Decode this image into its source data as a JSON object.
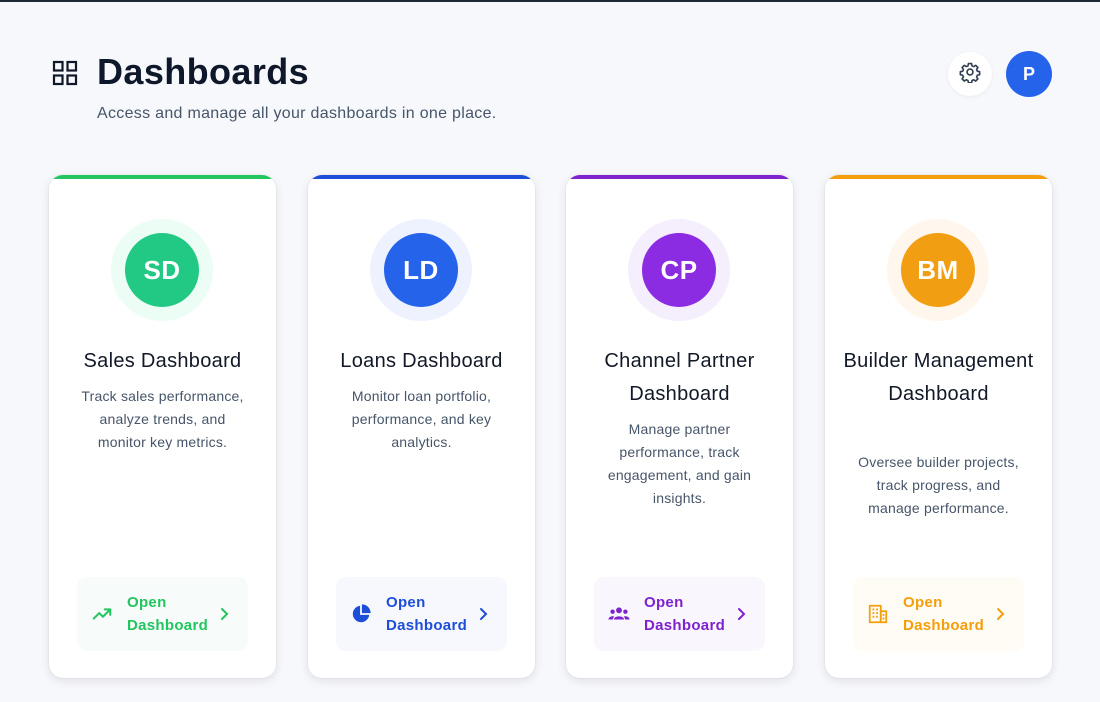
{
  "header": {
    "title": "Dashboards",
    "subtitle": "Access and manage all your dashboards in one place.",
    "avatar_initial": "P"
  },
  "cards": [
    {
      "initials": "SD",
      "title": "Sales Dashboard",
      "description": "Track sales performance, analyze trends, and monitor key metrics.",
      "button_label": "Open Dashboard",
      "icon": "trending-up-icon",
      "accent": "#22c55e",
      "badge_color": "#22c984"
    },
    {
      "initials": "LD",
      "title": "Loans Dashboard",
      "description": "Monitor loan portfolio, performance, and key analytics.",
      "button_label": "Open Dashboard",
      "icon": "pie-chart-icon",
      "accent": "#1d4ed8",
      "badge_color": "#2563eb"
    },
    {
      "initials": "CP",
      "title": "Channel Partner Dashboard",
      "description": "Manage partner performance, track engagement, and gain insights.",
      "button_label": "Open Dashboard",
      "icon": "people-group-icon",
      "accent": "#7e22ce",
      "badge_color": "#8b2be2"
    },
    {
      "initials": "BM",
      "title": "Builder Management Dashboard",
      "description": "Oversee builder projects, track progress, and manage performance.",
      "button_label": "Open Dashboard",
      "icon": "building-icon",
      "accent": "#f59e0b",
      "badge_color": "#f29e12"
    }
  ]
}
